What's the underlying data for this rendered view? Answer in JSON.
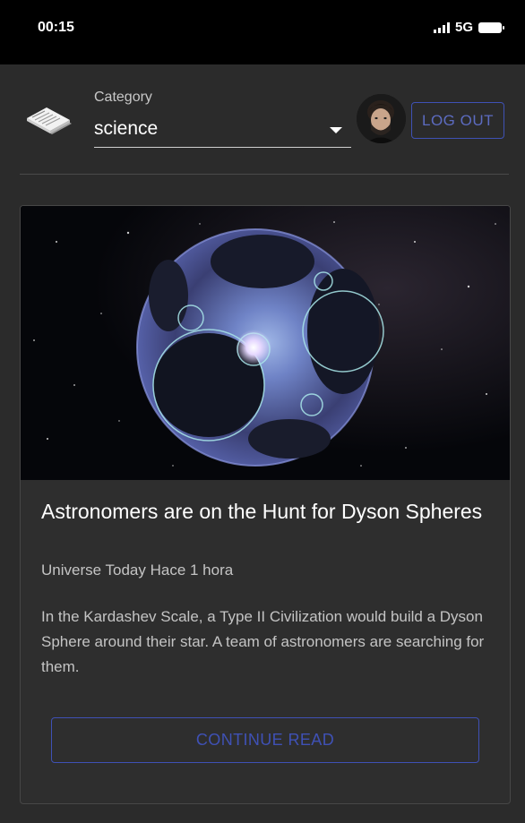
{
  "status_bar": {
    "time": "00:15",
    "network": "5G",
    "icons": [
      "signal-icon",
      "battery-icon"
    ]
  },
  "header": {
    "logo_icon": "newspaper-icon",
    "category_label": "Category",
    "category_value": "science",
    "avatar_icon": "user-avatar",
    "logout_label": "LOG OUT"
  },
  "article": {
    "image_subject": "dyson-sphere-image",
    "title": "Astronomers are on the Hunt for Dyson Spheres",
    "meta": "Universe Today Hace 1 hora",
    "description": "In the Kardashev Scale, a Type II Civilization would build a Dyson Sphere around their star. A team of astronomers are searching for them.",
    "action_label": "CONTINUE READ"
  },
  "colors": {
    "background": "#2b2b2b",
    "status_bar": "#000000",
    "accent": "#3f51b5",
    "card_border": "#474747"
  }
}
